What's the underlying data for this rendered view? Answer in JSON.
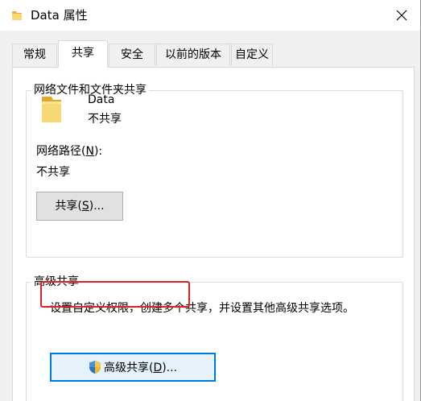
{
  "window": {
    "title": "Data 属性",
    "close_icon": "close-icon"
  },
  "tabs": [
    {
      "label": "常规",
      "active": false
    },
    {
      "label": "共享",
      "active": true
    },
    {
      "label": "安全",
      "active": false
    },
    {
      "label": "以前的版本",
      "active": false
    },
    {
      "label": "自定义",
      "active": false
    }
  ],
  "network_sharing": {
    "group_title": "网络文件和文件夹共享",
    "folder_name": "Data",
    "folder_state": "不共享",
    "path_label_prefix": "网络路径(",
    "path_label_key": "N",
    "path_label_suffix": "):",
    "path_value": "不共享",
    "share_button_prefix": "共享(",
    "share_button_key": "S",
    "share_button_suffix": ")..."
  },
  "advanced_sharing": {
    "group_title": "高级共享",
    "description": "设置自定义权限，创建多个共享，并设置其他高级共享选项。",
    "button_prefix": "高级共享(",
    "button_key": "D",
    "button_suffix": ")...",
    "button_icon": "uac-shield-icon"
  },
  "colors": {
    "accent": "#0078d7",
    "highlight": "#e02020",
    "folder_yellow": "#f8d775"
  }
}
